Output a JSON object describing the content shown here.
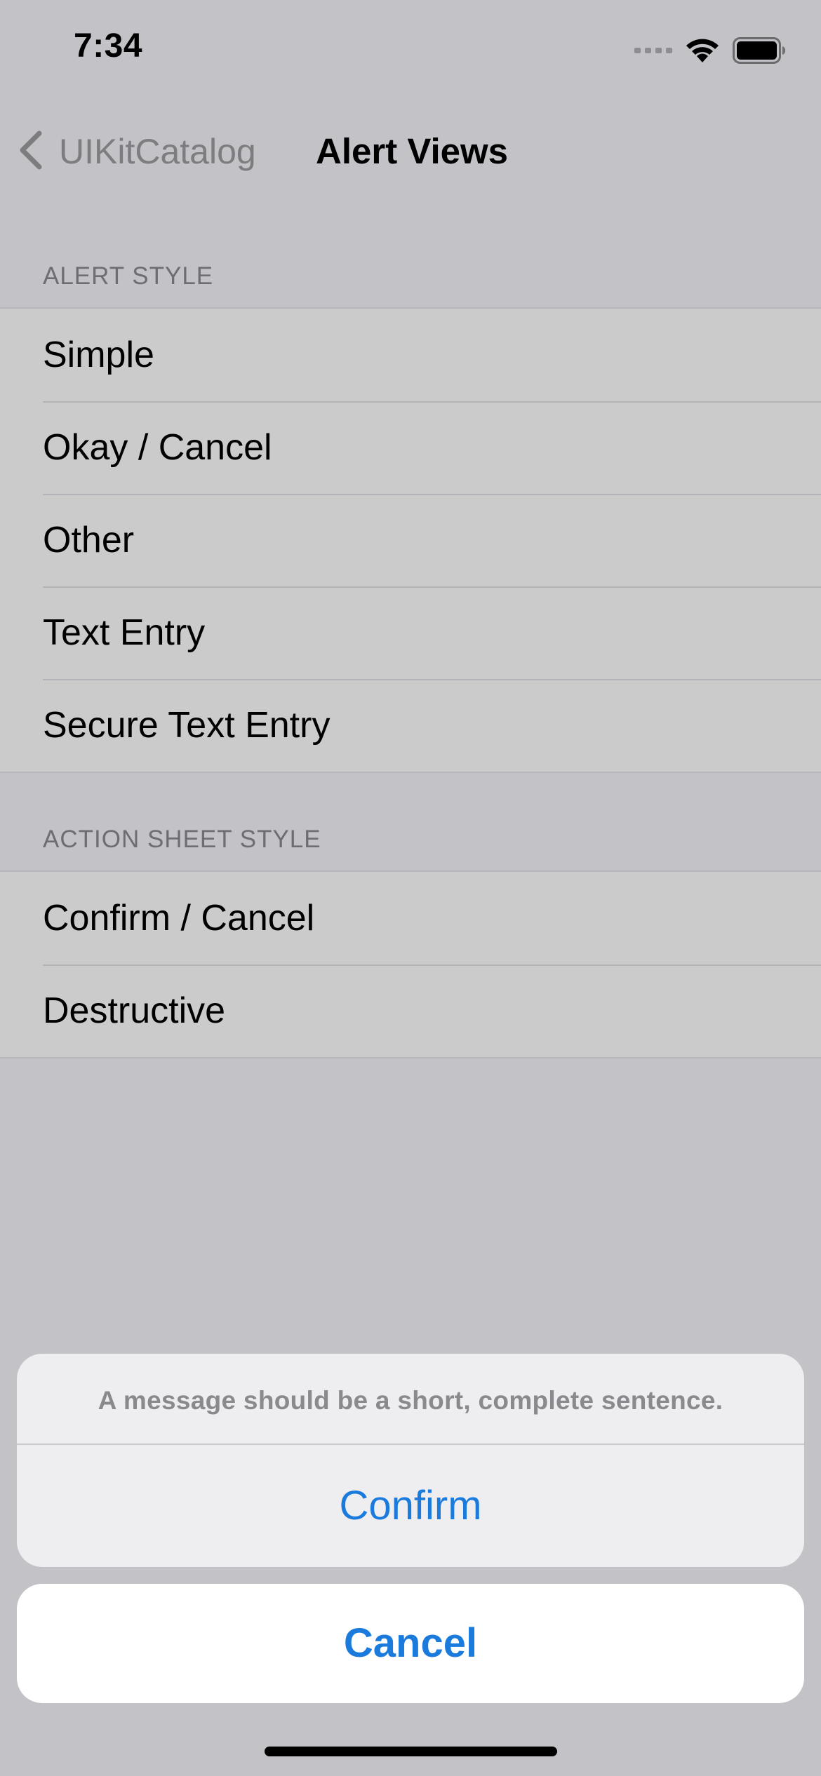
{
  "status_bar": {
    "time": "7:34",
    "icons": [
      "signal-dots-icon",
      "wifi-icon",
      "battery-icon"
    ]
  },
  "nav": {
    "back_label": "UIKitCatalog",
    "title": "Alert Views"
  },
  "sections": [
    {
      "header": "ALERT STYLE",
      "items": [
        "Simple",
        "Okay / Cancel",
        "Other",
        "Text Entry",
        "Secure Text Entry"
      ]
    },
    {
      "header": "ACTION SHEET STYLE",
      "items": [
        "Confirm / Cancel",
        "Destructive"
      ]
    }
  ],
  "action_sheet": {
    "message": "A message should be a short, complete sentence.",
    "confirm_label": "Confirm",
    "cancel_label": "Cancel"
  },
  "colors": {
    "accent": "#1b7bdc",
    "dimmed_background": "#c3c3c7",
    "cell_background": "#cbcbcb"
  }
}
